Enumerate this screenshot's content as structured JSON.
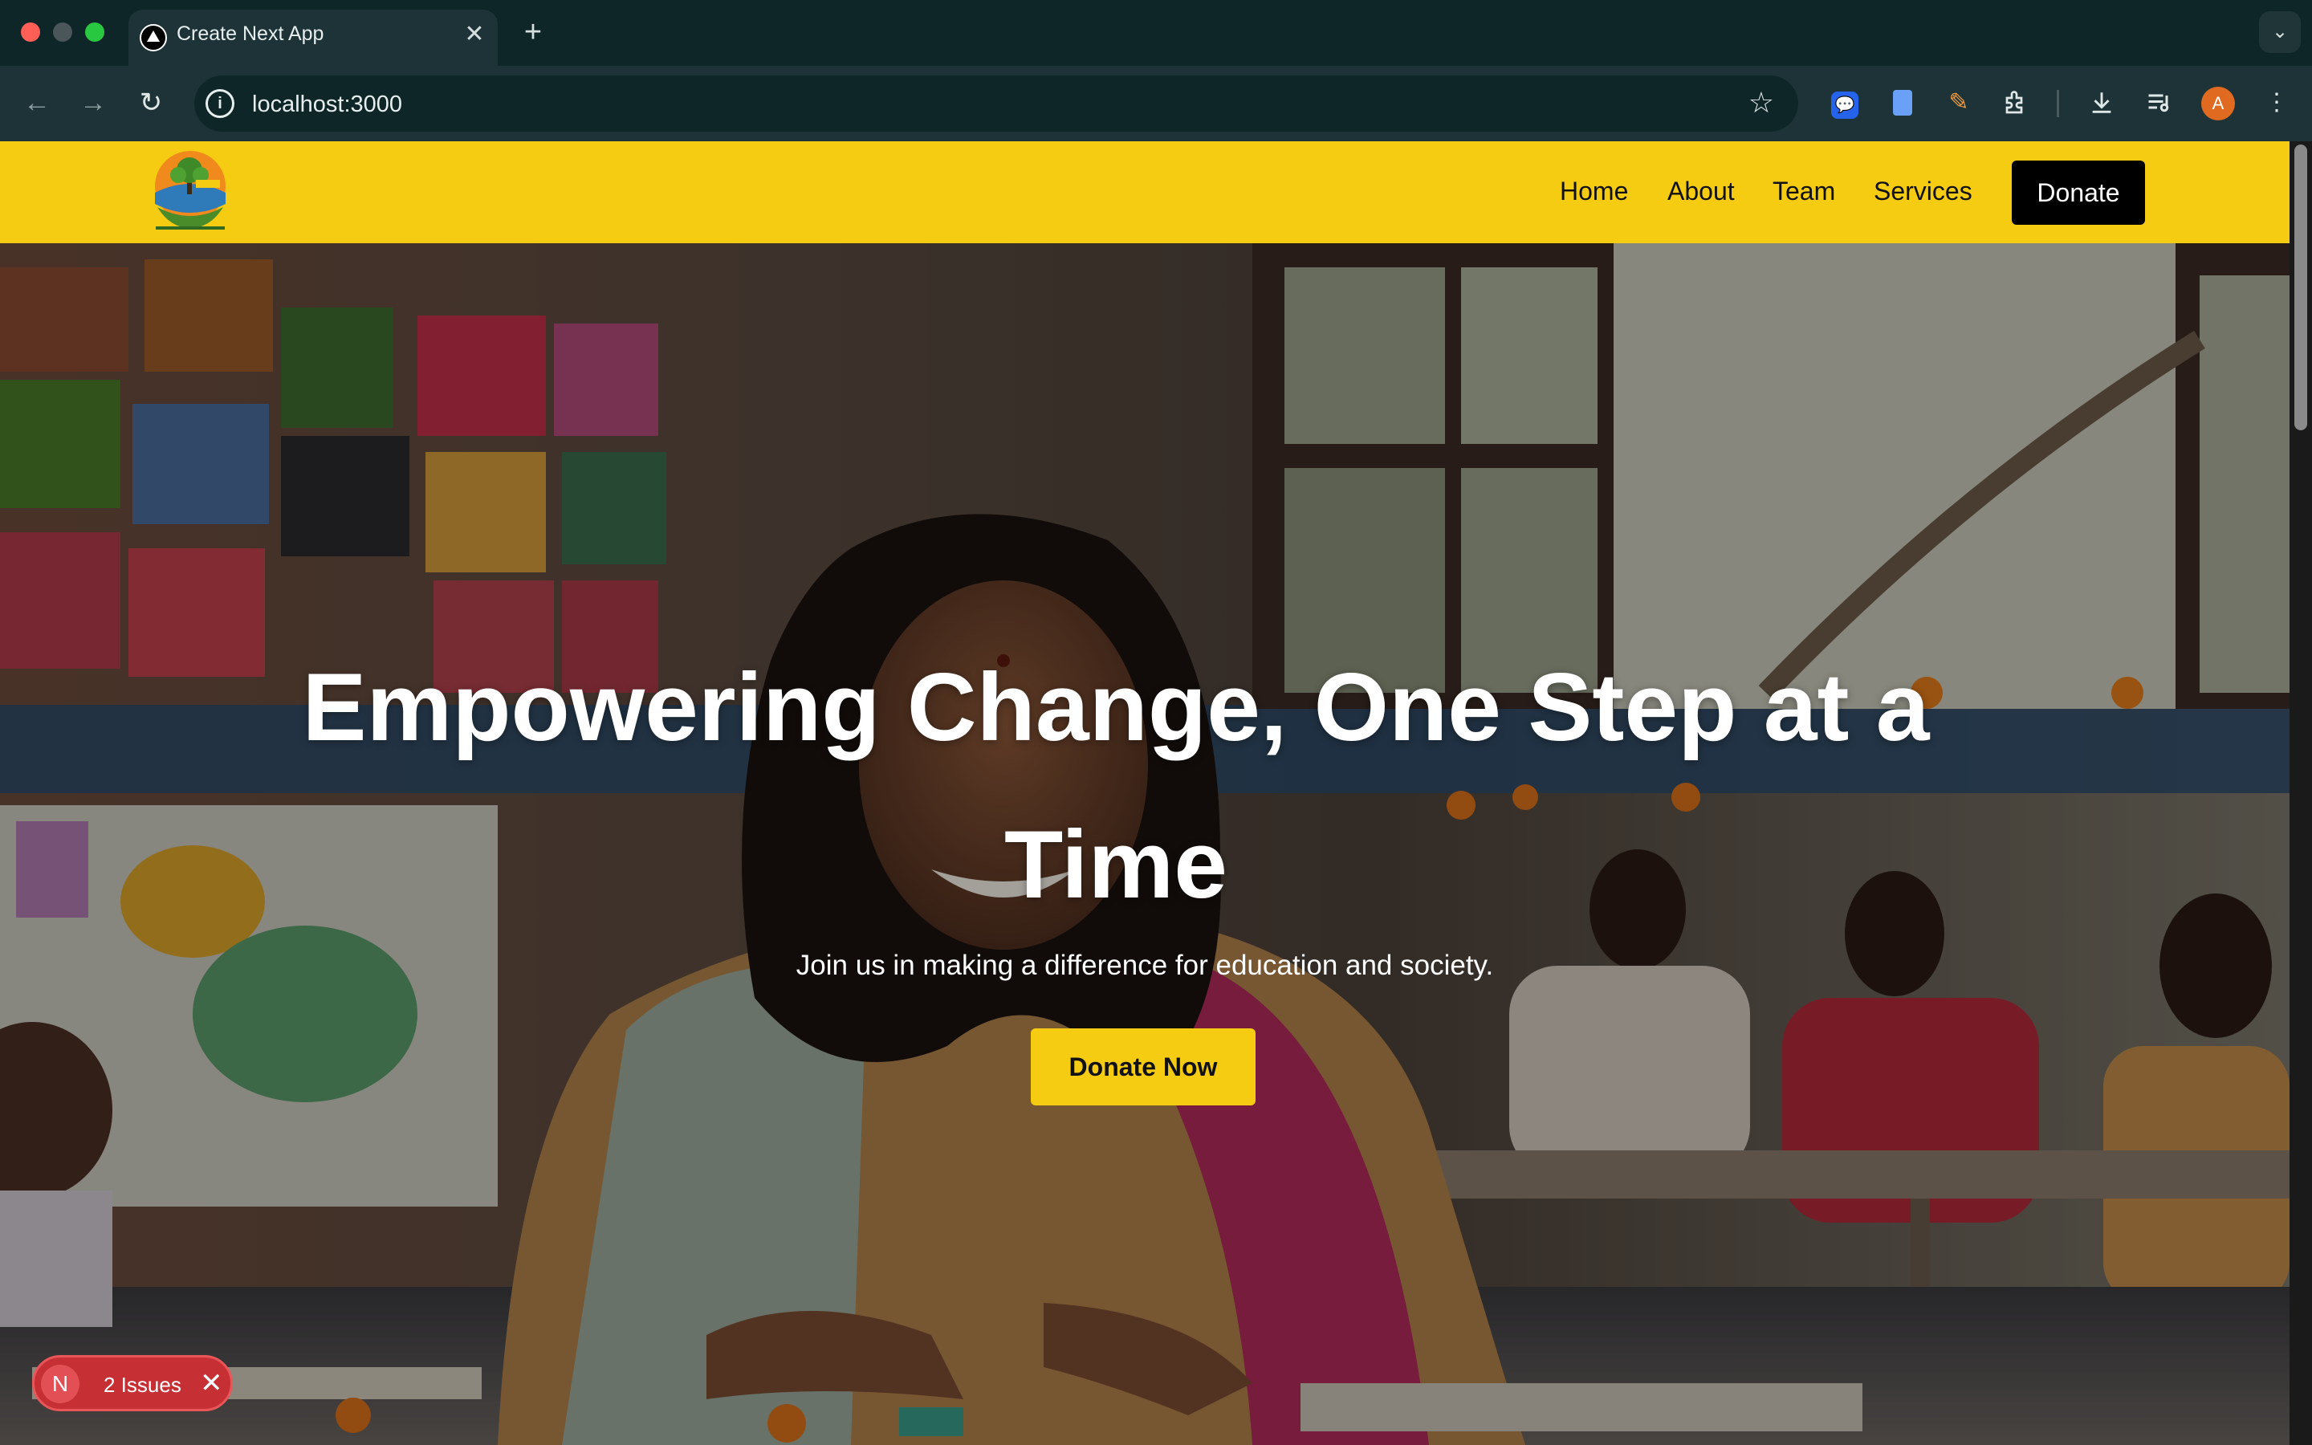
{
  "browser": {
    "tab_title": "Create Next App",
    "tab_close": "✕",
    "new_tab": "+",
    "tab_menu": "⌄",
    "url": "localhost:3000",
    "nav": {
      "back": "←",
      "forward": "→",
      "reload": "↻"
    },
    "site_info": "i",
    "bookmark": "☆",
    "profile_initial": "A",
    "kebab": "⋮",
    "icons": [
      "messenger-extension-icon",
      "docs-extension-icon",
      "pen-extension-icon",
      "extensions-puzzle-icon",
      "download-icon",
      "media-control-icon"
    ]
  },
  "site": {
    "nav": {
      "links": [
        "Home",
        "About",
        "Team",
        "Services"
      ],
      "donate": "Donate"
    },
    "hero": {
      "title": "Empowering Change, One Step at a Time",
      "subtitle": "Join us in making a difference for education and society.",
      "cta": "Donate Now"
    },
    "brand_color": "#f5cc12"
  },
  "devtools": {
    "badge_letter": "N",
    "issues_label": "2 Issues",
    "close": "✕"
  }
}
